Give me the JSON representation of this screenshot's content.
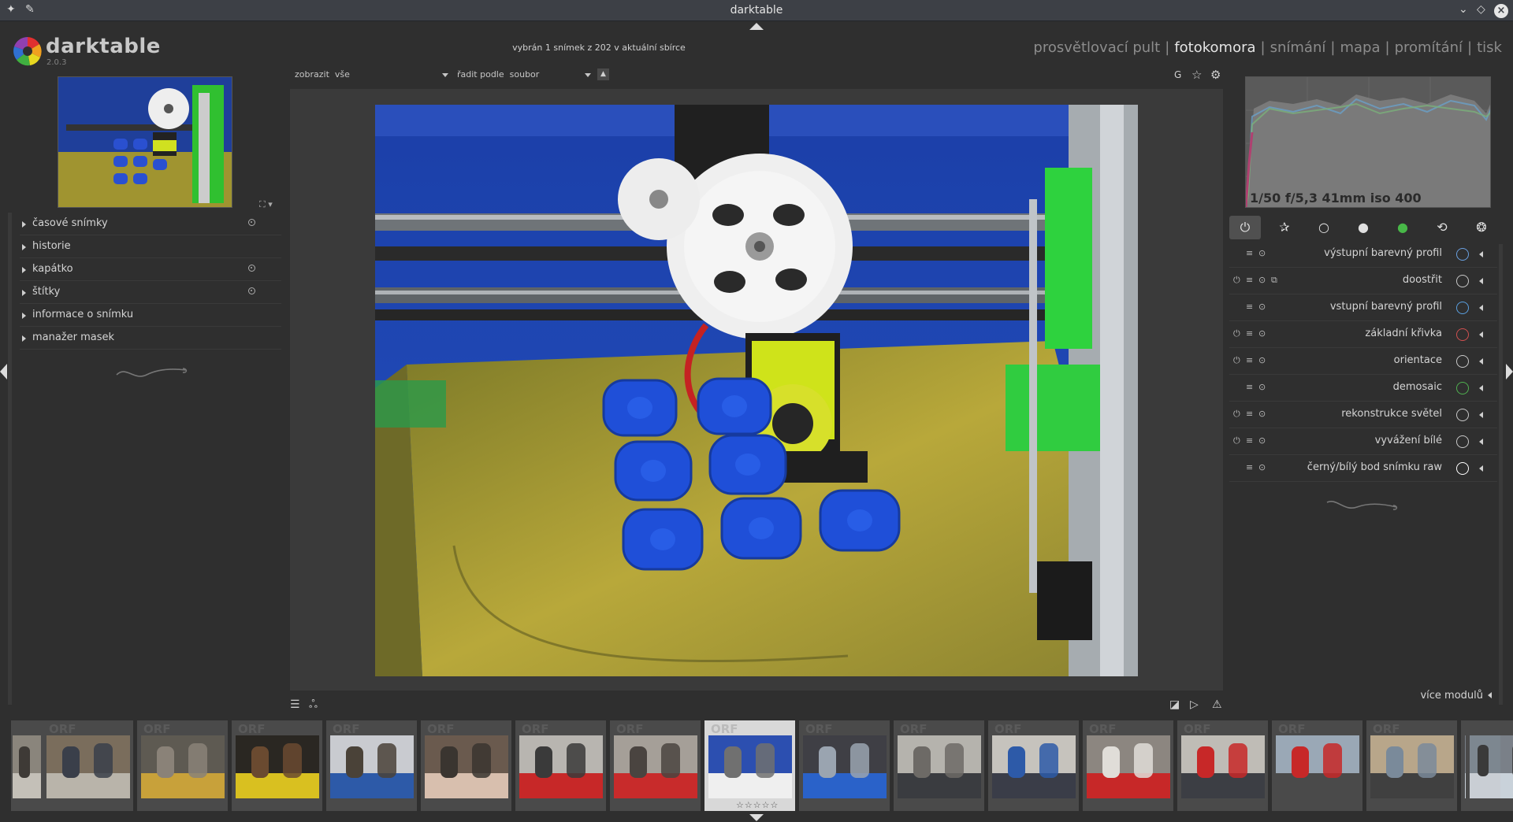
{
  "window": {
    "title": "darktable"
  },
  "logo": {
    "name": "darktable",
    "version": "2.0.3"
  },
  "header": {
    "selection_info": "vybrán 1 snímek z 202 v aktuální sbírce",
    "views": [
      {
        "label": "prosvětlovací pult",
        "active": false
      },
      {
        "label": "fotokomora",
        "active": true
      },
      {
        "label": "snímání",
        "active": false
      },
      {
        "label": "mapa",
        "active": false
      },
      {
        "label": "promítání",
        "active": false
      },
      {
        "label": "tisk",
        "active": false
      }
    ],
    "separator": "|"
  },
  "filter": {
    "show_label": "zobrazit",
    "show_value": "vše",
    "sort_label": "řadit podle",
    "sort_value": "soubor"
  },
  "top_icons": {
    "grouping": "G"
  },
  "left_panel": {
    "modules": [
      {
        "label": "časové snímky",
        "presets": true
      },
      {
        "label": "historie",
        "presets": false
      },
      {
        "label": "kapátko",
        "presets": true
      },
      {
        "label": "štítky",
        "presets": true
      },
      {
        "label": "informace o snímku",
        "presets": false
      },
      {
        "label": "manažer masek",
        "presets": false
      }
    ]
  },
  "histogram": {
    "exif": "1/50 f/5,3 41mm iso 400"
  },
  "right_panel": {
    "modules": [
      {
        "label": "výstupní barevný profil",
        "power": false,
        "mask": false
      },
      {
        "label": "doostřit",
        "power": true,
        "mask": true
      },
      {
        "label": "vstupní barevný profil",
        "power": false,
        "mask": false
      },
      {
        "label": "základní křivka",
        "power": true,
        "mask": false
      },
      {
        "label": "orientace",
        "power": true,
        "mask": false
      },
      {
        "label": "demosaic",
        "power": false,
        "mask": false
      },
      {
        "label": "rekonstrukce světel",
        "power": true,
        "mask": false
      },
      {
        "label": "vyvážení bílé",
        "power": true,
        "mask": false
      },
      {
        "label": "černý/bílý bod snímku raw",
        "power": false,
        "mask": false
      }
    ],
    "more_modules": "více modulů"
  },
  "filmstrip": {
    "ext_label": "ORF",
    "stars": "☆☆☆☆☆",
    "active_index": 7,
    "thumbs": [
      {
        "palette": [
          "#7a6d5c",
          "#b9b4aa",
          "#3a3f4a"
        ]
      },
      {
        "palette": [
          "#5e5a52",
          "#c8a13a",
          "#8a8278"
        ]
      },
      {
        "palette": [
          "#2a2722",
          "#d9c020",
          "#6a4a30"
        ]
      },
      {
        "palette": [
          "#c9cbd0",
          "#2d5aa8",
          "#4a4238"
        ]
      },
      {
        "palette": [
          "#6a5a4e",
          "#d8bfae",
          "#3a3530"
        ]
      },
      {
        "palette": [
          "#b8b5b0",
          "#c72828",
          "#3a3a3a"
        ]
      },
      {
        "palette": [
          "#a59f98",
          "#c82b2b",
          "#4a4440"
        ]
      },
      {
        "palette": [
          "#2c4fb0",
          "#efefef",
          "#707070"
        ]
      },
      {
        "palette": [
          "#3f3f45",
          "#2a62c9",
          "#9aa4b0"
        ]
      },
      {
        "palette": [
          "#b5b3ad",
          "#3a3c40",
          "#6d6a66"
        ]
      },
      {
        "palette": [
          "#c6c3bd",
          "#3a3d48",
          "#2d5aa8"
        ]
      },
      {
        "palette": [
          "#8c8680",
          "#c72828",
          "#e0ddd8"
        ]
      },
      {
        "palette": [
          "#bfbcb6",
          "#3c3e44",
          "#c72828"
        ]
      },
      {
        "palette": [
          "#9aa8b6",
          "#4a4a4a",
          "#c72828"
        ]
      },
      {
        "palette": [
          "#b8a68a",
          "#404040",
          "#7a8a9a"
        ]
      },
      {
        "palette": [
          "#7a8088",
          "#c9d2da",
          "#3a3a3a"
        ]
      }
    ]
  }
}
